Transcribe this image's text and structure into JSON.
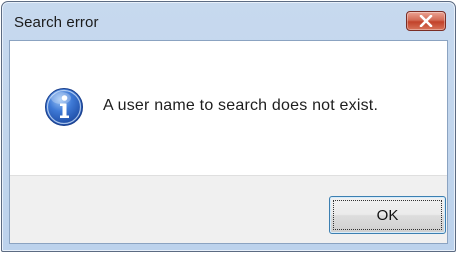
{
  "window": {
    "title": "Search error",
    "close_icon": "close-icon"
  },
  "message": {
    "icon": "info-icon",
    "text": "A user name to search does not exist."
  },
  "buttons": {
    "ok_label": "OK"
  },
  "colors": {
    "frame": "#bcd2ec",
    "close_button": "#c2422a",
    "info_icon": "#2f66c0",
    "footer": "#f0f0f0",
    "ok_border": "#3c7fb1"
  }
}
